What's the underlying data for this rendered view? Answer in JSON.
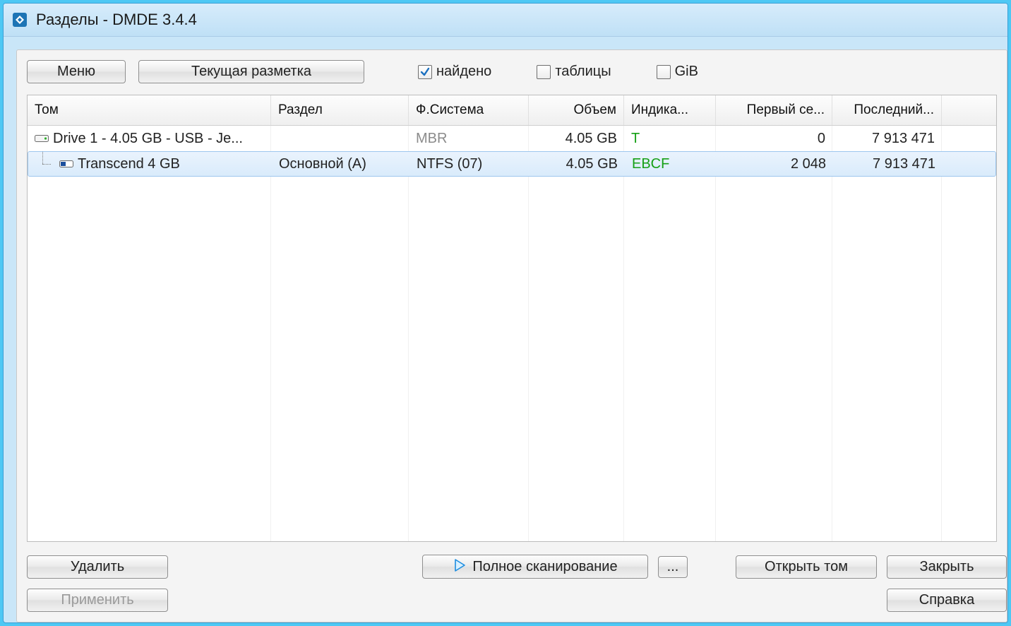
{
  "window": {
    "title": "Разделы - DMDE 3.4.4"
  },
  "toolbar": {
    "menu": "Меню",
    "current_layout": "Текущая разметка",
    "found": "найдено",
    "tables": "таблицы",
    "gib": "GiB"
  },
  "columns": {
    "volume": "Том",
    "partition": "Раздел",
    "fs": "Ф.Система",
    "size": "Объем",
    "indicator": "Индика...",
    "first_sector": "Первый се...",
    "last_sector": "Последний..."
  },
  "rows": [
    {
      "indent": 0,
      "icon": "drive",
      "label": "Drive 1 - 4.05 GB - USB - Je...",
      "partition": "",
      "fs": "MBR",
      "fs_muted": true,
      "size": "4.05 GB",
      "indicator": "T",
      "first": "0",
      "last": "7 913 471",
      "selected": false
    },
    {
      "indent": 1,
      "icon": "volume",
      "label": "Transcend 4 GB",
      "partition": "Основной (A)",
      "fs": "NTFS (07)",
      "fs_muted": false,
      "size": "4.05 GB",
      "indicator": "EBCF",
      "first": "2 048",
      "last": "7 913 471",
      "selected": true
    }
  ],
  "buttons": {
    "delete": "Удалить",
    "full_scan": "Полное сканирование",
    "more": "...",
    "open_volume": "Открыть том",
    "close": "Закрыть",
    "apply": "Применить",
    "help": "Справка"
  }
}
